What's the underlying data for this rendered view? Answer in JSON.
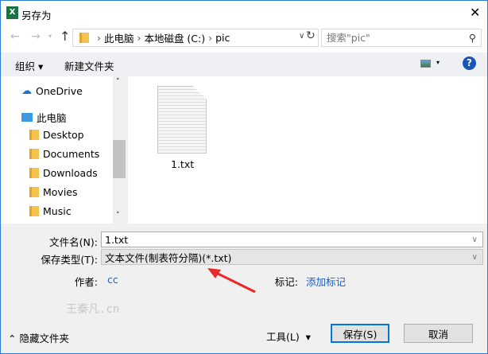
{
  "title": "另存为",
  "address": {
    "crumbs": [
      "此电脑",
      "本地磁盘 (C:)",
      "pic"
    ],
    "search_placeholder": "搜索\"pic\""
  },
  "toolbar": {
    "organize": "组织",
    "new_folder": "新建文件夹"
  },
  "nav": {
    "items": [
      "OneDrive",
      "此电脑",
      "Desktop",
      "Documents",
      "Downloads",
      "Movies",
      "Music"
    ]
  },
  "files": [
    {
      "name": "1.txt"
    }
  ],
  "form": {
    "filename_label": "文件名(N):",
    "filename_value": "1.txt",
    "type_label": "保存类型(T):",
    "type_value": "文本文件(制表符分隔)(*.txt)",
    "author_label": "作者:",
    "author_value": "cc",
    "tags_label": "标记:",
    "tags_value": "添加标记"
  },
  "watermark": "王秦凡.cn",
  "footer": {
    "hide_folders": "隐藏文件夹",
    "tools": "工具(L)",
    "save": "保存(S)",
    "cancel": "取消"
  },
  "colors": {
    "accent": "#2b79d8",
    "link": "#1a5fc6",
    "arrow": "#e8282b"
  }
}
